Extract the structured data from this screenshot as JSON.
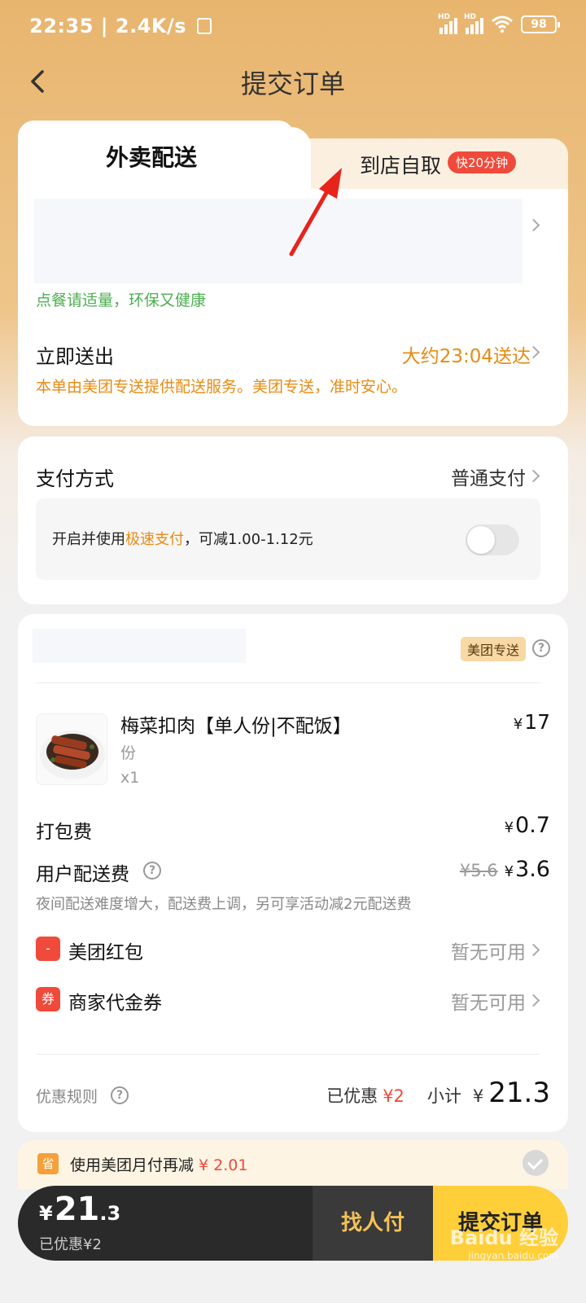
{
  "status_bar": {
    "time": "22:35",
    "speed": "2.4K/s",
    "hd1": "HD",
    "hd2": "HD",
    "battery": "98"
  },
  "nav": {
    "title": "提交订单"
  },
  "tabs": {
    "delivery_label": "外卖配送",
    "pickup_label": "到店自取",
    "pickup_badge": "快20分钟"
  },
  "delivery": {
    "eco_note": "点餐请适量，环保又健康",
    "send_now": "立即送出",
    "eta": "大约23:04送达",
    "service_note": "本单由美团专送提供配送服务。美团专送，准时安心。"
  },
  "payment": {
    "label": "支付方式",
    "value": "普通支付",
    "fast_prefix": "开启并使用",
    "fast_highlight": "极速支付",
    "fast_suffix": "，可减1.00-1.12元",
    "toggle_on": false
  },
  "order": {
    "delivery_badge": "美团专送",
    "item": {
      "name": "梅菜扣肉【单人份|不配饭】",
      "unit": "份",
      "qty": "x1",
      "yen": "¥",
      "price": "17"
    },
    "packing_label": "打包费",
    "packing_yen": "¥",
    "packing_value": "0.7",
    "delivery_fee_label": "用户配送费",
    "delivery_fee_original": "¥5.6",
    "delivery_fee_yen": "¥",
    "delivery_fee_value": "3.6",
    "fee_note": "夜间配送难度增大，配送费上调，另可享活动减2元配送费",
    "redpacket_icon": "-",
    "redpacket_label": "美团红包",
    "redpacket_value": "暂无可用",
    "voucher_icon": "券",
    "voucher_label": "商家代金券",
    "voucher_value": "暂无可用",
    "rules_label": "优惠规则",
    "discounted_label": "已优惠",
    "discounted_value": "¥2",
    "subtotal_label": "小计",
    "subtotal_yen": "¥",
    "subtotal_value": "21.3"
  },
  "promo": {
    "icon": "省",
    "text_prefix": "使用美团月付再减 ",
    "text_value": "¥ 2.01"
  },
  "bottom": {
    "yen": "¥",
    "total_int": "21",
    "total_dec": ".3",
    "discount_note": "已优惠¥2",
    "friend_pay": "找人付",
    "submit": "提交订单"
  },
  "watermark": {
    "main": "Baidu 经验",
    "sub": "jingyan.baidu.com"
  },
  "colors": {
    "accent_orange": "#e88b12",
    "green": "#4caf50",
    "red": "#f04a3a",
    "submit_yellow": "#ffcf3a"
  }
}
